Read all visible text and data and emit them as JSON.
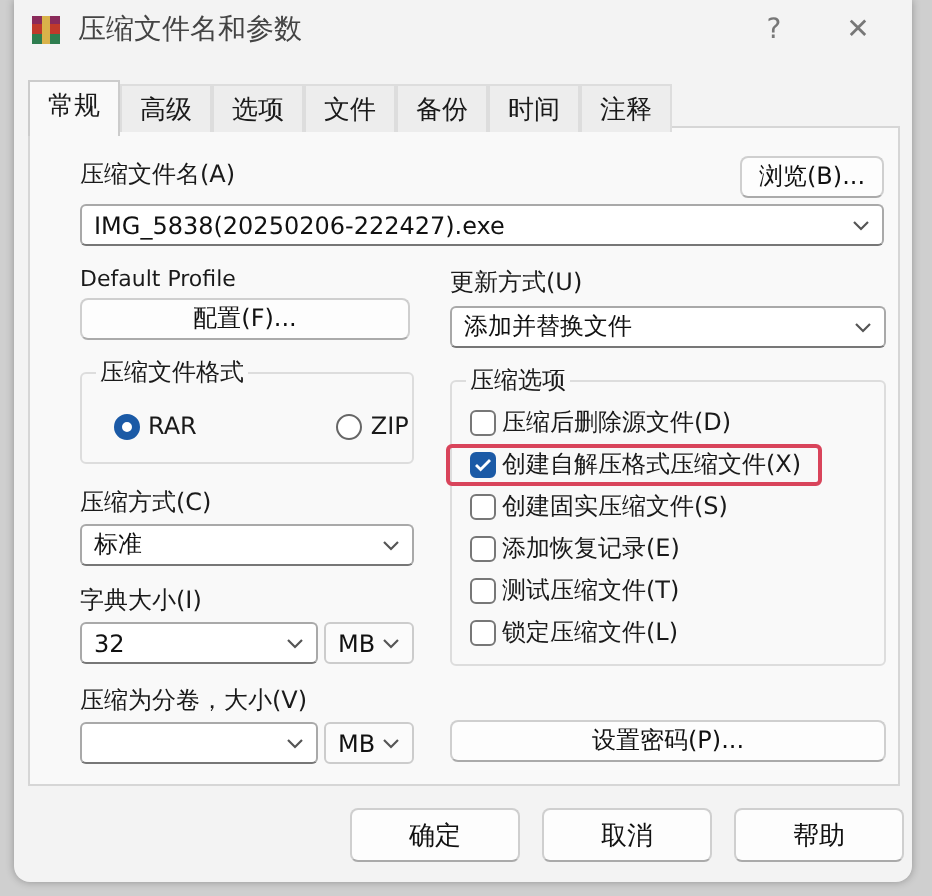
{
  "window": {
    "title": "压缩文件名和参数",
    "help": "?",
    "close": "✕"
  },
  "tabs": [
    {
      "label": "常规",
      "selected": true
    },
    {
      "label": "高级",
      "selected": false
    },
    {
      "label": "选项",
      "selected": false
    },
    {
      "label": "文件",
      "selected": false
    },
    {
      "label": "备份",
      "selected": false
    },
    {
      "label": "时间",
      "selected": false
    },
    {
      "label": "注释",
      "selected": false
    }
  ],
  "archive_name": {
    "label": "压缩文件名(A)",
    "value": "IMG_5838(20250206-222427).exe",
    "browse_button": "浏览(B)..."
  },
  "profile": {
    "label": "Default Profile",
    "button": "配置(F)..."
  },
  "update_mode": {
    "label": "更新方式(U)",
    "value": "添加并替换文件"
  },
  "archive_format": {
    "label": "压缩文件格式",
    "options": [
      {
        "label": "RAR",
        "selected": true
      },
      {
        "label": "ZIP",
        "selected": false
      }
    ]
  },
  "compression_method": {
    "label": "压缩方式(C)",
    "value": "标准"
  },
  "dictionary_size": {
    "label": "字典大小(I)",
    "value": "32",
    "unit": "MB"
  },
  "split_volumes": {
    "label": "压缩为分卷，大小(V)",
    "unit": "MB"
  },
  "archive_options": {
    "label": "压缩选项",
    "options": [
      {
        "label": "压缩后删除源文件(D)",
        "checked": false,
        "highlighted": false
      },
      {
        "label": "创建自解压格式压缩文件(X)",
        "checked": true,
        "highlighted": true
      },
      {
        "label": "创建固实压缩文件(S)",
        "checked": false,
        "highlighted": false
      },
      {
        "label": "添加恢复记录(E)",
        "checked": false,
        "highlighted": false
      },
      {
        "label": "测试压缩文件(T)",
        "checked": false,
        "highlighted": false
      },
      {
        "label": "锁定压缩文件(L)",
        "checked": false,
        "highlighted": false
      }
    ]
  },
  "password_button": "设置密码(P)...",
  "buttons": [
    "确定",
    "取消",
    "帮助"
  ]
}
